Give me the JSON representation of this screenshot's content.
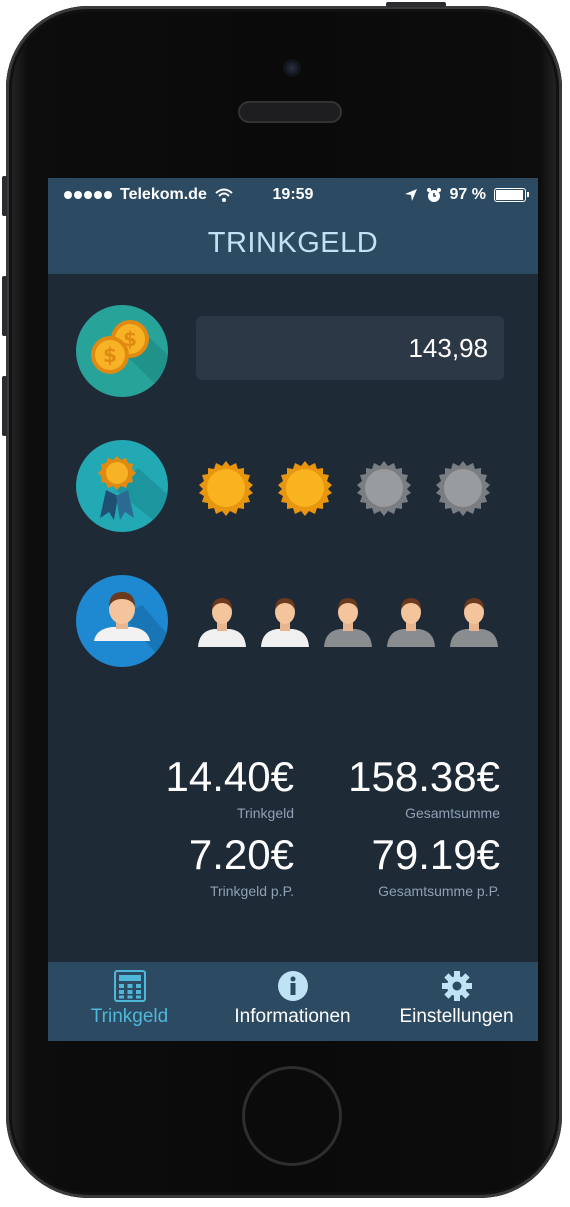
{
  "status_bar": {
    "carrier": "Telekom.de",
    "time": "19:59",
    "battery_percent": "97 %"
  },
  "nav": {
    "title": "TRINKGELD"
  },
  "bill": {
    "amount": "143,98"
  },
  "rating": {
    "selected": 2,
    "total": 4
  },
  "people": {
    "selected": 2,
    "total": 5
  },
  "results": {
    "tip_value": "14.40€",
    "tip_label": "Trinkgeld",
    "total_value": "158.38€",
    "total_label": "Gesamtsumme",
    "tip_pp_value": "7.20€",
    "tip_pp_label": "Trinkgeld p.P.",
    "total_pp_value": "79.19€",
    "total_pp_label": "Gesamtsumme p.P."
  },
  "tabs": [
    {
      "label": "Trinkgeld",
      "icon": "calculator-icon",
      "active": true
    },
    {
      "label": "Informationen",
      "icon": "info-icon",
      "active": false
    },
    {
      "label": "Einstellungen",
      "icon": "gear-icon",
      "active": false
    }
  ],
  "colors": {
    "background": "#1f2a37",
    "bar": "#2c4a62",
    "active_tab": "#4fb7d8",
    "title": "#bfe3f5",
    "label": "#8ea0b3"
  }
}
